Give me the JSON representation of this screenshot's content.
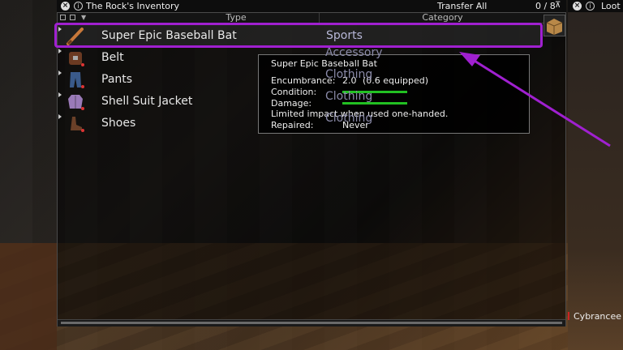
{
  "inventory": {
    "title": "The Rock's Inventory",
    "transfer_all": "Transfer All",
    "weight": "0 / 8",
    "columns": {
      "type": "Type",
      "category": "Category"
    },
    "items": [
      {
        "name": "Super Epic Baseball Bat",
        "category": "Sports",
        "icon": "baseball-bat-icon",
        "selected": true
      },
      {
        "name": "Belt",
        "category": "Accessory",
        "icon": "belt-icon",
        "selected": false
      },
      {
        "name": "Pants",
        "category": "Clothing",
        "icon": "pants-icon",
        "selected": false
      },
      {
        "name": "Shell Suit Jacket",
        "category": "Clothing",
        "icon": "jacket-icon",
        "selected": false
      },
      {
        "name": "Shoes",
        "category": "Clothing",
        "icon": "shoes-icon",
        "selected": false
      }
    ]
  },
  "loot": {
    "title": "Loot"
  },
  "tooltip": {
    "title": "Super Epic Baseball Bat",
    "encumbrance_label": "Encumbrance:",
    "encumbrance_value": "2.0",
    "encumbrance_equipped": "(0.6 equipped)",
    "condition_label": "Condition:",
    "condition_level": 1.0,
    "damage_label": "Damage:",
    "damage_level": 1.0,
    "note": "Limited impact when used one-handed.",
    "repaired_label": "Repaired:",
    "repaired_value": "Never"
  },
  "player": {
    "name": "Cybrancee"
  },
  "colors": {
    "highlight": "#a020d0",
    "bar": "#22c022",
    "category_text": "#8a8aa8"
  }
}
